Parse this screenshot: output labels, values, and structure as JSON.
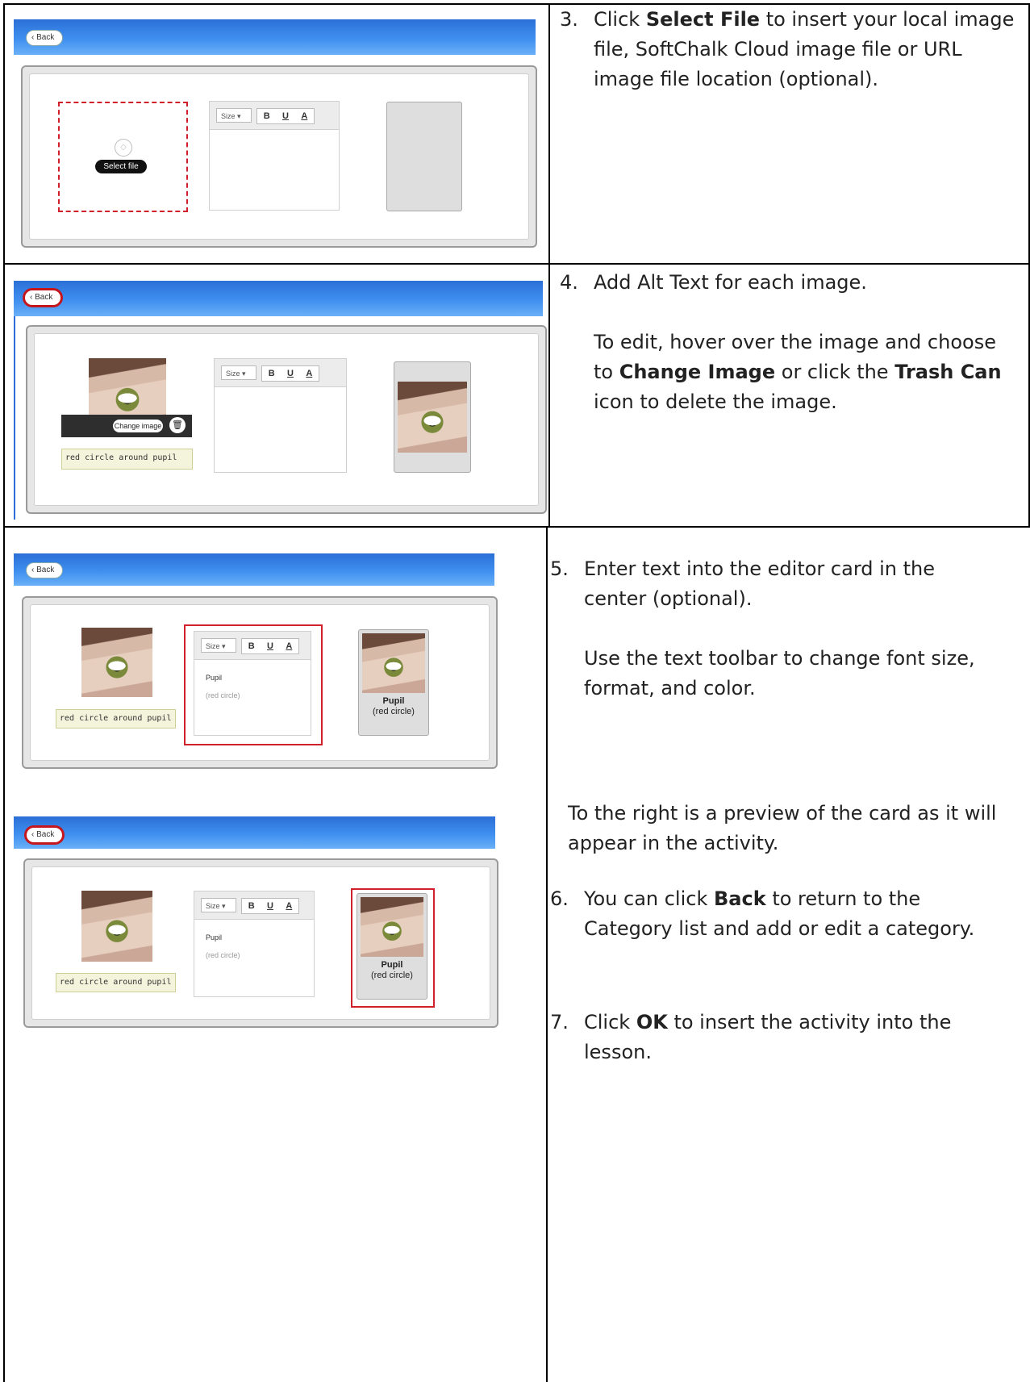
{
  "steps": {
    "s3": {
      "num": "3.",
      "pre": "Click ",
      "bold": "Select File",
      "post": " to insert your local image file, SoftChalk Cloud image file or URL image file location (optional)."
    },
    "s4": {
      "num": "4.",
      "line1": "Add Alt Text for each image.",
      "p2_pre": "To edit, hover over the image and choose to ",
      "p2_b1": "Change Image",
      "p2_mid": " or click the ",
      "p2_b2": "Trash Can",
      "p2_post": " icon to delete the image."
    },
    "s5": {
      "num": "5.",
      "line1": "Enter text into the editor card in the center (optional).",
      "line2": "Use the text toolbar to change font size, format, and color."
    },
    "preview_note": "To the right is a preview of the card as it will appear in the activity.",
    "s6": {
      "num": "6.",
      "pre": "You can click ",
      "bold": "Back",
      "post": " to return to the Category list and add or edit a category."
    },
    "s7": {
      "num": "7.",
      "pre": "Click ",
      "bold": "OK",
      "post": " to insert the activity into the lesson."
    }
  },
  "ui": {
    "back_label": "Back",
    "select_file_label": "Select file",
    "change_image_label": "Change image",
    "size_label": "Size",
    "bold_btn": "B",
    "underline_btn": "U",
    "color_btn": "A",
    "alt_text": "red circle around pupil",
    "editor_title": "Pupil",
    "editor_sub": "(red circle)",
    "card_title": "Pupil",
    "card_sub": "(red circle)"
  }
}
